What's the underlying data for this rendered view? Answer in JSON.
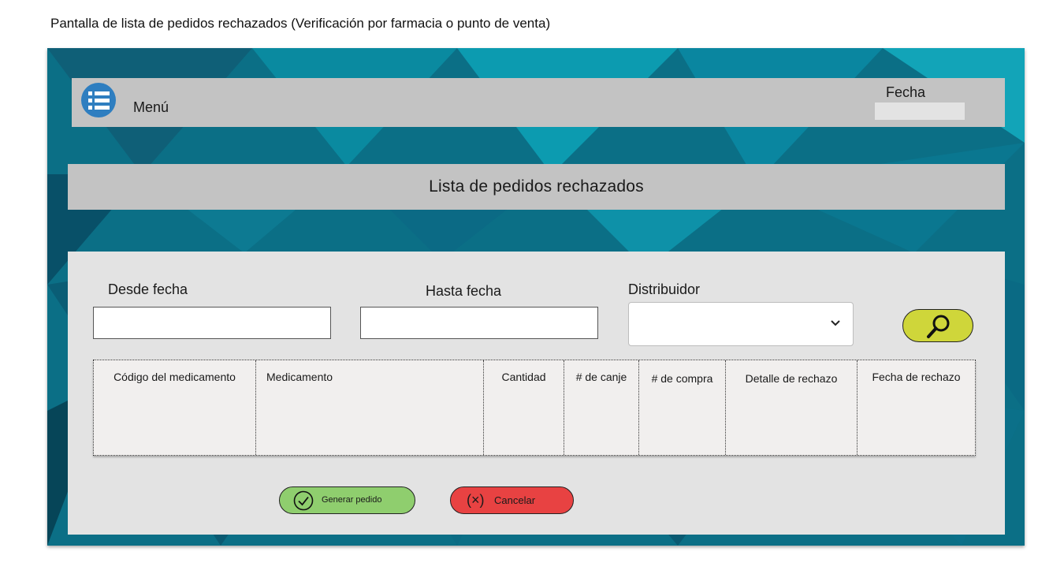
{
  "caption": "Pantalla de lista de pedidos rechazados (Verificación por farmacia o punto de venta)",
  "header": {
    "menu_icon": "list-menu-icon",
    "menu_label": "Menú",
    "date_label": "Fecha",
    "date_value": ""
  },
  "title": "Lista de pedidos rechazados",
  "filters": {
    "from_label": "Desde fecha",
    "from_value": "",
    "to_label": "Hasta fecha",
    "to_value": "",
    "distributor_label": "Distribuidor",
    "distributor_value": "",
    "search_icon": "magnifier-icon"
  },
  "table": {
    "columns": [
      "Código del medicamento",
      "Medicamento",
      "Cantidad",
      "# de canje",
      "# de compra",
      "Detalle de rechazo",
      "Fecha de rechazo"
    ],
    "rows": []
  },
  "actions": {
    "generate_label": "Generar pedido",
    "generate_icon": "check-circle-icon",
    "cancel_label": "Cancelar",
    "cancel_icon": "x-parentheses-icon"
  },
  "colors": {
    "background_teal": "#0b6f86",
    "bar_gray": "#c3c3c3",
    "panel_gray": "#e3e3e3",
    "menu_blue": "#2e7ec0",
    "search_yellow": "#cfd63a",
    "generate_green": "#8fce6e",
    "cancel_red": "#e84242"
  }
}
